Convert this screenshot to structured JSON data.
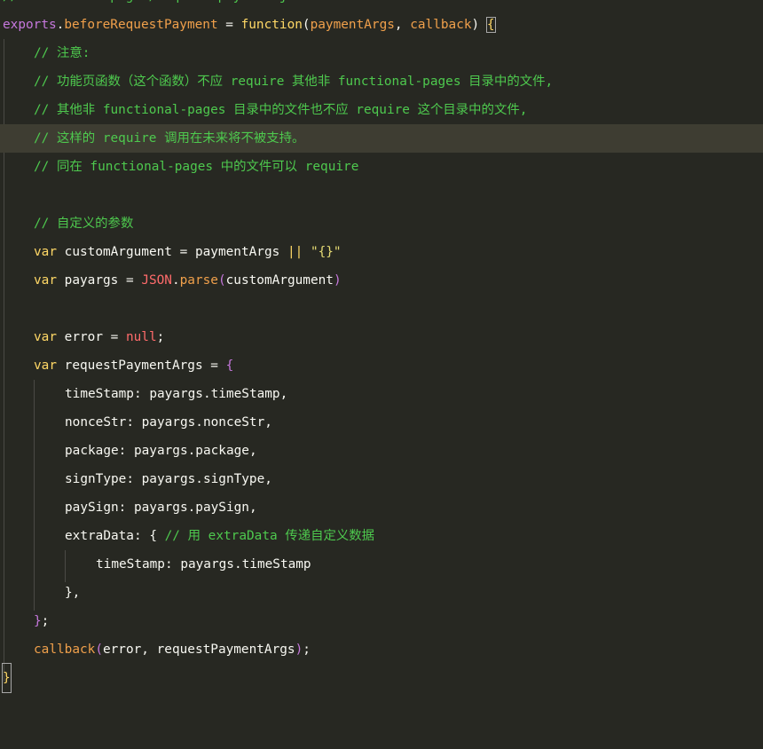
{
  "file_comment": "// functional-pages/request-payment.js",
  "lines": {
    "l1": {
      "obj": "exports",
      "dot": ".",
      "prop": "beforeRequestPayment",
      "eq": " = ",
      "fn": "function",
      "open": "(",
      "p1": "paymentArgs",
      "comma": ", ",
      "p2": "callback",
      "close": ") ",
      "brace": "{"
    },
    "c1": "// 注意:",
    "c2": "// 功能页函数（这个函数）不应 require 其他非 functional-pages 目录中的文件,",
    "c3": "// 其他非 functional-pages 目录中的文件也不应 require 这个目录中的文件,",
    "c4": "// 这样的 require 调用在未来将不被支持。",
    "c5": "// 同在 functional-pages 中的文件可以 require",
    "c6": "// 自定义的参数",
    "v1": {
      "kw": "var",
      "name": " customArgument",
      "eq": " = ",
      "val": "paymentArgs",
      "op": " || ",
      "str": "\"{}\""
    },
    "v2": {
      "kw": "var",
      "name": " payargs",
      "eq": " = ",
      "json": "JSON",
      "dot": ".",
      "parse": "parse",
      "open": "(",
      "arg": "customArgument",
      "close": ")"
    },
    "v3": {
      "kw": "var",
      "name": " error",
      "eq": " = ",
      "nul": "null",
      "semi": ";"
    },
    "v4": {
      "kw": "var",
      "name": " requestPaymentArgs",
      "eq": " = ",
      "brace": "{"
    },
    "props": [
      {
        "key": "timeStamp",
        "colon": ": ",
        "val": "payargs.timeStamp,"
      },
      {
        "key": "nonceStr",
        "colon": ": ",
        "val": "payargs.nonceStr,"
      },
      {
        "key": "package",
        "colon": ": ",
        "val": "payargs.package,"
      },
      {
        "key": "signType",
        "colon": ": ",
        "val": "payargs.signType,"
      },
      {
        "key": "paySign",
        "colon": ": ",
        "val": "payargs.paySign,"
      }
    ],
    "extra": {
      "key": "extraData",
      "colon": ": ",
      "brace": "{ ",
      "comment": "// 用 extraData 传递自定义数据"
    },
    "inner": {
      "key": "timeStamp",
      "colon": ": ",
      "val": "payargs.timeStamp"
    },
    "close_inner": "},",
    "close_obj_brace": "}",
    "close_obj_semi": ";",
    "cb": {
      "fn": "callback",
      "open": "(",
      "args": "error, requestPaymentArgs",
      "close": ")",
      "semi": ";"
    },
    "final": "}"
  }
}
